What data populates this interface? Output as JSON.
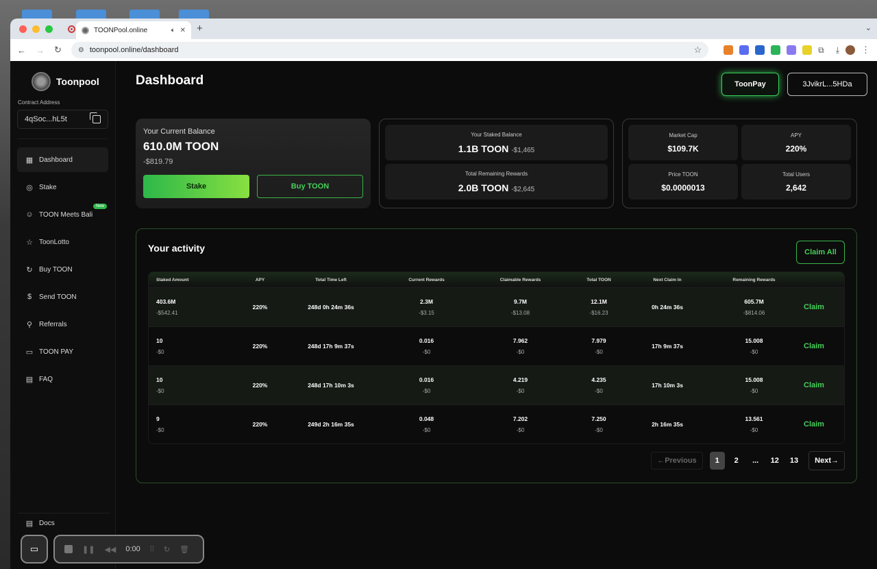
{
  "browser": {
    "tab_title": "TOONPool.online",
    "url": "toonpool.online/dashboard"
  },
  "sidebar": {
    "brand": "Toonpool",
    "contract_label": "Contract Address",
    "contract_value": "4qSoc...hL5t",
    "items": [
      {
        "label": "Dashboard",
        "icon": "grid-icon",
        "glyph": "▦"
      },
      {
        "label": "Stake",
        "icon": "coins-icon",
        "glyph": "◎"
      },
      {
        "label": "TOON Meets Bali",
        "icon": "globe-icon",
        "glyph": "☺",
        "badge": "New"
      },
      {
        "label": "ToonLotto",
        "icon": "star-icon",
        "glyph": "☆"
      },
      {
        "label": "Buy TOON",
        "icon": "refresh-icon",
        "glyph": "↻"
      },
      {
        "label": "Send TOON",
        "icon": "coin-send-icon",
        "glyph": "$"
      },
      {
        "label": "Referrals",
        "icon": "share-icon",
        "glyph": "⚲"
      },
      {
        "label": "TOON PAY",
        "icon": "card-icon",
        "glyph": "▭"
      },
      {
        "label": "FAQ",
        "icon": "document-icon",
        "glyph": "▤"
      }
    ],
    "docs_label": "Docs"
  },
  "header": {
    "title": "Dashboard",
    "toonpay_label": "ToonPay",
    "wallet_label": "3JvikrL...5HDa"
  },
  "balance": {
    "label": "Your Current Balance",
    "amount": "610.0M TOON",
    "usd": "-$819.79",
    "stake_label": "Stake",
    "buy_label": "Buy TOON"
  },
  "staked": {
    "label": "Your Staked Balance",
    "value": "1.1B TOON",
    "usd": "-$1,465",
    "rewards_label": "Total Remaining Rewards",
    "rewards_value": "2.0B TOON",
    "rewards_usd": "-$2,645"
  },
  "market": {
    "cap_label": "Market Cap",
    "cap_value": "$109.7K",
    "apy_label": "APY",
    "apy_value": "220%",
    "price_label": "Price TOON",
    "price_value": "$0.0000013",
    "users_label": "Total Users",
    "users_value": "2,642"
  },
  "activity": {
    "title": "Your activity",
    "claim_all_label": "Claim All",
    "columns": [
      "Staked Amount",
      "APY",
      "Total Time Left",
      "Current Rewards",
      "Claimable Rewards",
      "Total TOON",
      "Next Claim In",
      "Remaining Rewards",
      ""
    ],
    "rows": [
      {
        "staked": "403.6M",
        "staked_usd": "-$542.41",
        "apy": "220%",
        "time_left": "248d 0h 24m 36s",
        "current": "2.3M",
        "current_usd": "-$3.15",
        "claimable": "9.7M",
        "claimable_usd": "-$13.08",
        "total": "12.1M",
        "total_usd": "-$16.23",
        "next": "0h 24m 36s",
        "remaining": "605.7M",
        "remaining_usd": "-$814.06",
        "action": "Claim"
      },
      {
        "staked": "10",
        "staked_usd": "-$0",
        "apy": "220%",
        "time_left": "248d 17h 9m 37s",
        "current": "0.016",
        "current_usd": "-$0",
        "claimable": "7.962",
        "claimable_usd": "-$0",
        "total": "7.979",
        "total_usd": "-$0",
        "next": "17h 9m 37s",
        "remaining": "15.008",
        "remaining_usd": "-$0",
        "action": "Claim"
      },
      {
        "staked": "10",
        "staked_usd": "-$0",
        "apy": "220%",
        "time_left": "248d 17h 10m 3s",
        "current": "0.016",
        "current_usd": "-$0",
        "claimable": "4.219",
        "claimable_usd": "-$0",
        "total": "4.235",
        "total_usd": "-$0",
        "next": "17h 10m 3s",
        "remaining": "15.008",
        "remaining_usd": "-$0",
        "action": "Claim"
      },
      {
        "staked": "9",
        "staked_usd": "-$0",
        "apy": "220%",
        "time_left": "249d 2h 16m 35s",
        "current": "0.048",
        "current_usd": "-$0",
        "claimable": "7.202",
        "claimable_usd": "-$0",
        "total": "7.250",
        "total_usd": "-$0",
        "next": "2h 16m 35s",
        "remaining": "13.561",
        "remaining_usd": "-$0",
        "action": "Claim"
      }
    ],
    "pagination": {
      "previous_label": "Previous",
      "pages": [
        "1",
        "2",
        "...",
        "12",
        "13"
      ],
      "current": "1",
      "next_label": "Next"
    }
  },
  "recorder": {
    "time": "0:00"
  }
}
